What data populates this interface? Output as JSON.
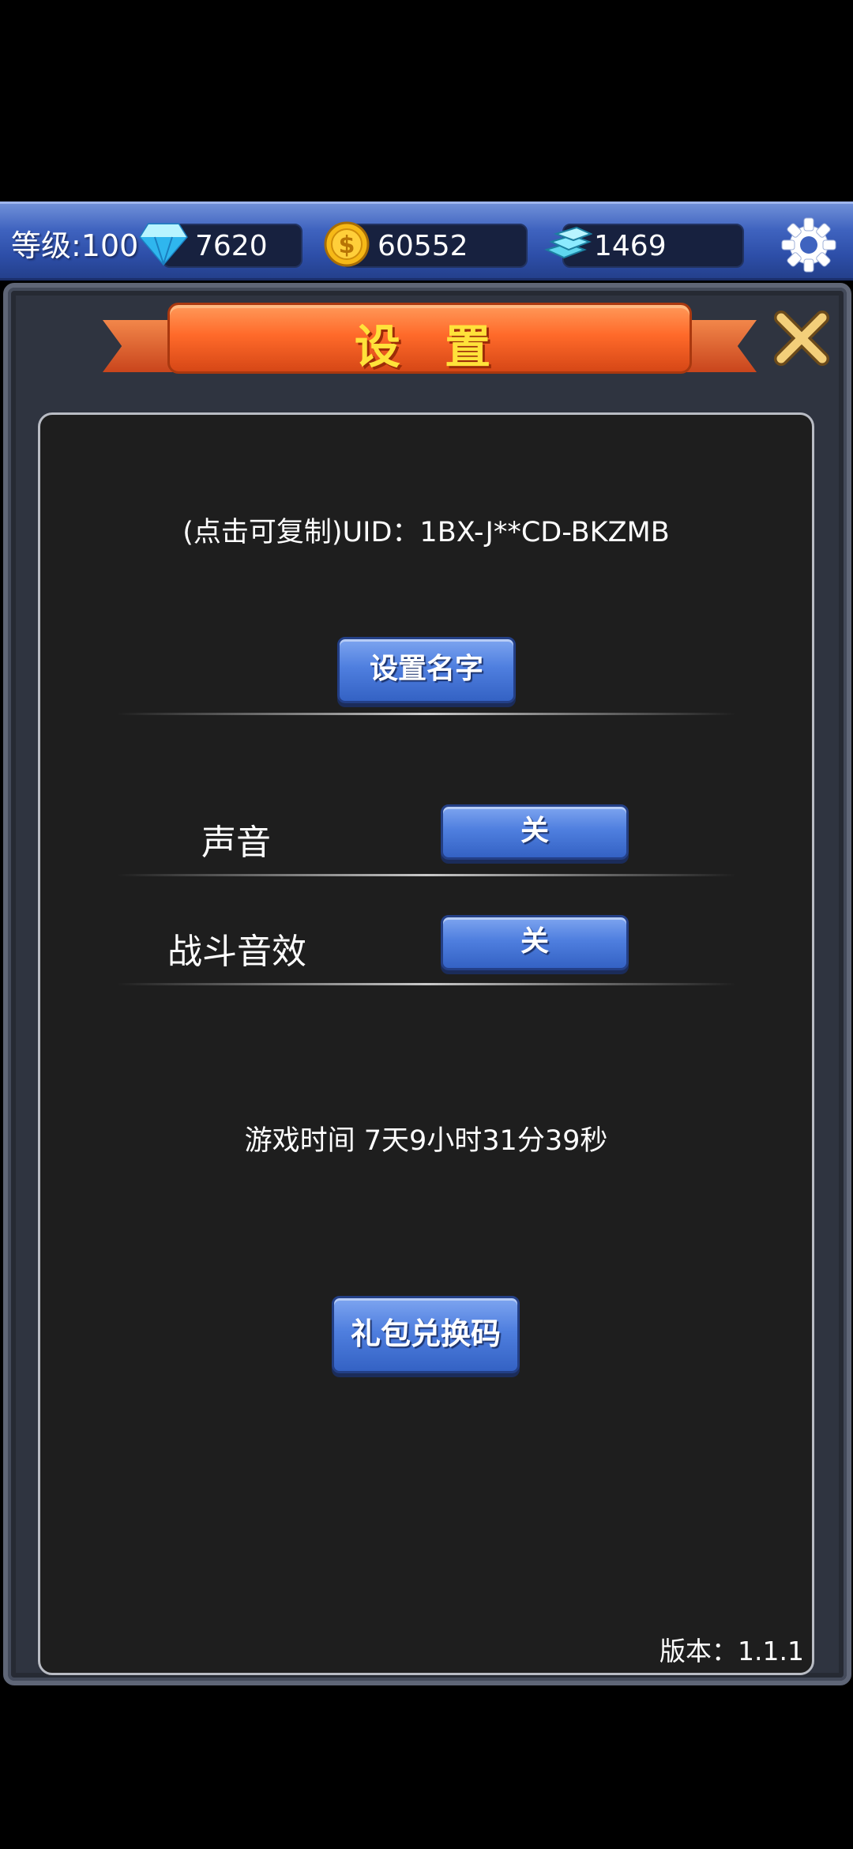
{
  "topbar": {
    "level_label": "等级:100",
    "resources": [
      {
        "icon": "diamond-icon",
        "value": "7620"
      },
      {
        "icon": "gold-coin-icon",
        "value": "60552"
      },
      {
        "icon": "blue-bars-icon",
        "value": "1469"
      }
    ],
    "settings_icon": "gear-icon"
  },
  "dialog": {
    "title": "设 置",
    "close_icon": "close-x-icon",
    "uid_text": "(点击可复制)UID：1BX-J**CD-BKZMB",
    "set_name_button": "设置名字",
    "sound": {
      "label": "声音",
      "value": "关"
    },
    "battle_sfx": {
      "label": "战斗音效",
      "value": "关"
    },
    "play_time": "游戏时间 7天9小时31分39秒",
    "gift_code_button": "礼包兑换码",
    "version": "版本：1.1.1"
  },
  "colors": {
    "topbar": "#3f63bf",
    "ribbon": "#ff6a2a",
    "title": "#ffe23a",
    "button": "#4f7fdf",
    "panel": "#1e1e1e"
  }
}
